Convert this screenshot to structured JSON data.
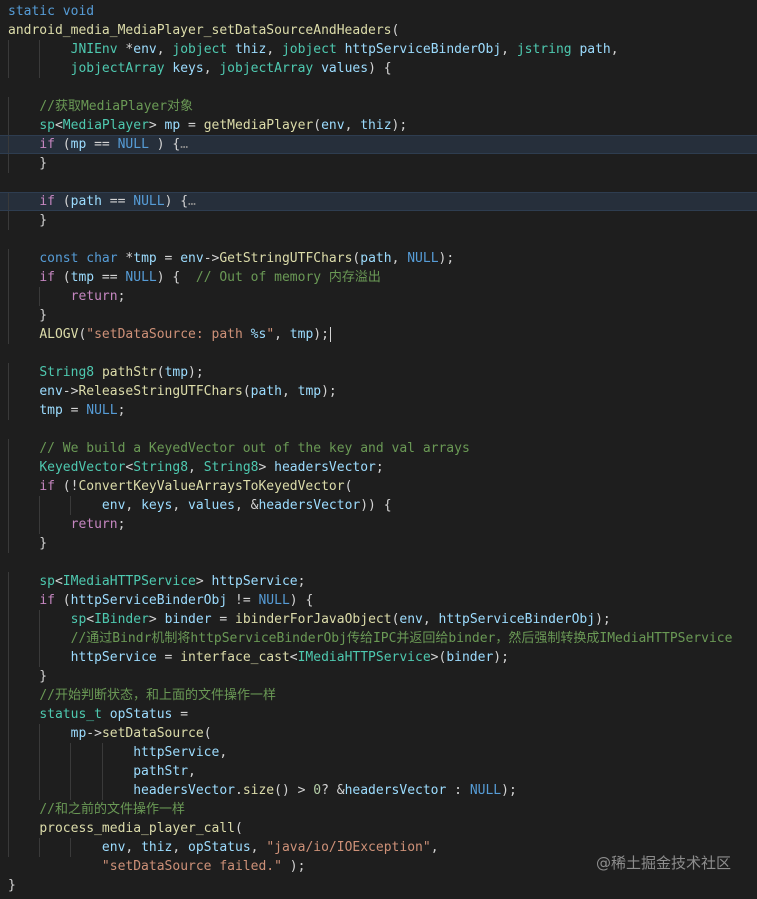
{
  "lines": [
    [
      [
        "kw",
        "static void"
      ]
    ],
    [
      [
        "fn",
        "android_media_MediaPlayer_setDataSourceAndHeaders"
      ],
      [
        "pl",
        "("
      ]
    ],
    [
      [
        "pl",
        "        "
      ],
      [
        "ty",
        "JNIEnv"
      ],
      [
        "pl",
        " *"
      ],
      [
        "var",
        "env"
      ],
      [
        "pl",
        ", "
      ],
      [
        "ty",
        "jobject"
      ],
      [
        "pl",
        " "
      ],
      [
        "var",
        "thiz"
      ],
      [
        "pl",
        ", "
      ],
      [
        "ty",
        "jobject"
      ],
      [
        "pl",
        " "
      ],
      [
        "var",
        "httpServiceBinderObj"
      ],
      [
        "pl",
        ", "
      ],
      [
        "ty",
        "jstring"
      ],
      [
        "pl",
        " "
      ],
      [
        "var",
        "path"
      ],
      [
        "pl",
        ","
      ]
    ],
    [
      [
        "pl",
        "        "
      ],
      [
        "ty",
        "jobjectArray"
      ],
      [
        "pl",
        " "
      ],
      [
        "var",
        "keys"
      ],
      [
        "pl",
        ", "
      ],
      [
        "ty",
        "jobjectArray"
      ],
      [
        "pl",
        " "
      ],
      [
        "var",
        "values"
      ],
      [
        "pl",
        ") {"
      ]
    ],
    [],
    [
      [
        "pl",
        "    "
      ],
      [
        "cmt",
        "//获取MediaPlayer对象"
      ]
    ],
    [
      [
        "pl",
        "    "
      ],
      [
        "ty",
        "sp"
      ],
      [
        "pl",
        "<"
      ],
      [
        "ty",
        "MediaPlayer"
      ],
      [
        "pl",
        "> "
      ],
      [
        "var",
        "mp"
      ],
      [
        "pl",
        " = "
      ],
      [
        "fn",
        "getMediaPlayer"
      ],
      [
        "pl",
        "("
      ],
      [
        "var",
        "env"
      ],
      [
        "pl",
        ", "
      ],
      [
        "var",
        "thiz"
      ],
      [
        "pl",
        ");"
      ]
    ],
    [
      [
        "pl",
        "    "
      ],
      [
        "ctl",
        "if"
      ],
      [
        "pl",
        " ("
      ],
      [
        "var",
        "mp"
      ],
      [
        "pl",
        " == "
      ],
      [
        "kw",
        "NULL"
      ],
      [
        "pl",
        " ) {"
      ],
      [
        "fold",
        "…"
      ]
    ],
    [
      [
        "pl",
        "    }"
      ]
    ],
    [],
    [
      [
        "pl",
        "    "
      ],
      [
        "ctl",
        "if"
      ],
      [
        "pl",
        " ("
      ],
      [
        "var",
        "path"
      ],
      [
        "pl",
        " == "
      ],
      [
        "kw",
        "NULL"
      ],
      [
        "pl",
        ") {"
      ],
      [
        "fold",
        "…"
      ]
    ],
    [
      [
        "pl",
        "    }"
      ]
    ],
    [],
    [
      [
        "pl",
        "    "
      ],
      [
        "kw",
        "const"
      ],
      [
        "pl",
        " "
      ],
      [
        "kw",
        "char"
      ],
      [
        "pl",
        " *"
      ],
      [
        "var",
        "tmp"
      ],
      [
        "pl",
        " = "
      ],
      [
        "var",
        "env"
      ],
      [
        "pl",
        "->"
      ],
      [
        "fn",
        "GetStringUTFChars"
      ],
      [
        "pl",
        "("
      ],
      [
        "var",
        "path"
      ],
      [
        "pl",
        ", "
      ],
      [
        "kw",
        "NULL"
      ],
      [
        "pl",
        ");"
      ]
    ],
    [
      [
        "pl",
        "    "
      ],
      [
        "ctl",
        "if"
      ],
      [
        "pl",
        " ("
      ],
      [
        "var",
        "tmp"
      ],
      [
        "pl",
        " == "
      ],
      [
        "kw",
        "NULL"
      ],
      [
        "pl",
        ") {  "
      ],
      [
        "cmt",
        "// Out of memory 内存溢出"
      ]
    ],
    [
      [
        "pl",
        "        "
      ],
      [
        "ctl",
        "return"
      ],
      [
        "pl",
        ";"
      ]
    ],
    [
      [
        "pl",
        "    }"
      ]
    ],
    [
      [
        "pl",
        "    "
      ],
      [
        "fn",
        "ALOGV"
      ],
      [
        "pl",
        "("
      ],
      [
        "str",
        "\"setDataSource: path "
      ],
      [
        "esc",
        "%s"
      ],
      [
        "str",
        "\""
      ],
      [
        "pl",
        ", "
      ],
      [
        "var",
        "tmp"
      ],
      [
        "pl",
        ");"
      ]
    ],
    [],
    [
      [
        "pl",
        "    "
      ],
      [
        "ty",
        "String8"
      ],
      [
        "pl",
        " "
      ],
      [
        "fn",
        "pathStr"
      ],
      [
        "pl",
        "("
      ],
      [
        "var",
        "tmp"
      ],
      [
        "pl",
        ");"
      ]
    ],
    [
      [
        "pl",
        "    "
      ],
      [
        "var",
        "env"
      ],
      [
        "pl",
        "->"
      ],
      [
        "fn",
        "ReleaseStringUTFChars"
      ],
      [
        "pl",
        "("
      ],
      [
        "var",
        "path"
      ],
      [
        "pl",
        ", "
      ],
      [
        "var",
        "tmp"
      ],
      [
        "pl",
        ");"
      ]
    ],
    [
      [
        "pl",
        "    "
      ],
      [
        "var",
        "tmp"
      ],
      [
        "pl",
        " = "
      ],
      [
        "kw",
        "NULL"
      ],
      [
        "pl",
        ";"
      ]
    ],
    [],
    [
      [
        "pl",
        "    "
      ],
      [
        "cmt",
        "// We build a KeyedVector out of the key and val arrays"
      ]
    ],
    [
      [
        "pl",
        "    "
      ],
      [
        "ty",
        "KeyedVector"
      ],
      [
        "pl",
        "<"
      ],
      [
        "ty",
        "String8"
      ],
      [
        "pl",
        ", "
      ],
      [
        "ty",
        "String8"
      ],
      [
        "pl",
        "> "
      ],
      [
        "var",
        "headersVector"
      ],
      [
        "pl",
        ";"
      ]
    ],
    [
      [
        "pl",
        "    "
      ],
      [
        "ctl",
        "if"
      ],
      [
        "pl",
        " (!"
      ],
      [
        "fn",
        "ConvertKeyValueArraysToKeyedVector"
      ],
      [
        "pl",
        "("
      ]
    ],
    [
      [
        "pl",
        "            "
      ],
      [
        "var",
        "env"
      ],
      [
        "pl",
        ", "
      ],
      [
        "var",
        "keys"
      ],
      [
        "pl",
        ", "
      ],
      [
        "var",
        "values"
      ],
      [
        "pl",
        ", &"
      ],
      [
        "var",
        "headersVector"
      ],
      [
        "pl",
        ")) {"
      ]
    ],
    [
      [
        "pl",
        "        "
      ],
      [
        "ctl",
        "return"
      ],
      [
        "pl",
        ";"
      ]
    ],
    [
      [
        "pl",
        "    }"
      ]
    ],
    [],
    [
      [
        "pl",
        "    "
      ],
      [
        "ty",
        "sp"
      ],
      [
        "pl",
        "<"
      ],
      [
        "ty",
        "IMediaHTTPService"
      ],
      [
        "pl",
        "> "
      ],
      [
        "var",
        "httpService"
      ],
      [
        "pl",
        ";"
      ]
    ],
    [
      [
        "pl",
        "    "
      ],
      [
        "ctl",
        "if"
      ],
      [
        "pl",
        " ("
      ],
      [
        "var",
        "httpServiceBinderObj"
      ],
      [
        "pl",
        " != "
      ],
      [
        "kw",
        "NULL"
      ],
      [
        "pl",
        ") {"
      ]
    ],
    [
      [
        "pl",
        "        "
      ],
      [
        "ty",
        "sp"
      ],
      [
        "pl",
        "<"
      ],
      [
        "ty",
        "IBinder"
      ],
      [
        "pl",
        "> "
      ],
      [
        "var",
        "binder"
      ],
      [
        "pl",
        " = "
      ],
      [
        "fn",
        "ibinderForJavaObject"
      ],
      [
        "pl",
        "("
      ],
      [
        "var",
        "env"
      ],
      [
        "pl",
        ", "
      ],
      [
        "var",
        "httpServiceBinderObj"
      ],
      [
        "pl",
        ");"
      ]
    ],
    [
      [
        "pl",
        "        "
      ],
      [
        "cmt",
        "//通过Bindr机制将httpServiceBinderObj传给IPC并返回给binder，然后强制转换成IMediaHTTPService"
      ]
    ],
    [
      [
        "pl",
        "        "
      ],
      [
        "var",
        "httpService"
      ],
      [
        "pl",
        " = "
      ],
      [
        "fn",
        "interface_cast"
      ],
      [
        "pl",
        "<"
      ],
      [
        "ty",
        "IMediaHTTPService"
      ],
      [
        "pl",
        ">("
      ],
      [
        "var",
        "binder"
      ],
      [
        "pl",
        ");"
      ]
    ],
    [
      [
        "pl",
        "    }"
      ]
    ],
    [
      [
        "pl",
        "    "
      ],
      [
        "cmt",
        "//开始判断状态，和上面的文件操作一样"
      ]
    ],
    [
      [
        "pl",
        "    "
      ],
      [
        "ty",
        "status_t"
      ],
      [
        "pl",
        " "
      ],
      [
        "var",
        "opStatus"
      ],
      [
        "pl",
        " ="
      ]
    ],
    [
      [
        "pl",
        "        "
      ],
      [
        "var",
        "mp"
      ],
      [
        "pl",
        "->"
      ],
      [
        "fn",
        "setDataSource"
      ],
      [
        "pl",
        "("
      ]
    ],
    [
      [
        "pl",
        "                "
      ],
      [
        "var",
        "httpService"
      ],
      [
        "pl",
        ","
      ]
    ],
    [
      [
        "pl",
        "                "
      ],
      [
        "var",
        "pathStr"
      ],
      [
        "pl",
        ","
      ]
    ],
    [
      [
        "pl",
        "                "
      ],
      [
        "var",
        "headersVector"
      ],
      [
        "pl",
        "."
      ],
      [
        "fn",
        "size"
      ],
      [
        "pl",
        "() > "
      ],
      [
        "num",
        "0"
      ],
      [
        "pl",
        "? &"
      ],
      [
        "var",
        "headersVector"
      ],
      [
        "pl",
        " : "
      ],
      [
        "kw",
        "NULL"
      ],
      [
        "pl",
        ");"
      ]
    ],
    [
      [
        "pl",
        "    "
      ],
      [
        "cmt",
        "//和之前的文件操作一样"
      ]
    ],
    [
      [
        "pl",
        "    "
      ],
      [
        "fn",
        "process_media_player_call"
      ],
      [
        "pl",
        "("
      ]
    ],
    [
      [
        "pl",
        "            "
      ],
      [
        "var",
        "env"
      ],
      [
        "pl",
        ", "
      ],
      [
        "var",
        "thiz"
      ],
      [
        "pl",
        ", "
      ],
      [
        "var",
        "opStatus"
      ],
      [
        "pl",
        ", "
      ],
      [
        "str",
        "\"java/io/IOException\""
      ],
      [
        "pl",
        ","
      ]
    ],
    [
      [
        "pl",
        "            "
      ],
      [
        "str",
        "\"setDataSource failed.\""
      ],
      [
        "pl",
        " );"
      ]
    ],
    [
      [
        "pl",
        "}"
      ]
    ]
  ],
  "watermark": "@稀土掘金技术社区"
}
